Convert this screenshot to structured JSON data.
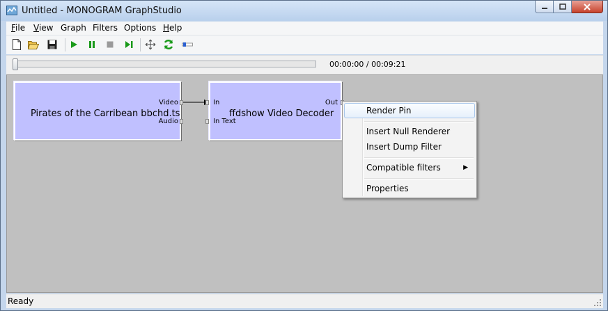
{
  "window": {
    "title": "Untitled - MONOGRAM GraphStudio"
  },
  "menubar": [
    {
      "id": "file",
      "key": "F",
      "rest": "ile"
    },
    {
      "id": "view",
      "key": "V",
      "rest": "iew"
    },
    {
      "id": "graph",
      "key": "",
      "rest": "Graph"
    },
    {
      "id": "filters",
      "key": "",
      "rest": "Filters"
    },
    {
      "id": "options",
      "key": "",
      "rest": "Options"
    },
    {
      "id": "help",
      "key": "H",
      "rest": "elp"
    }
  ],
  "toolbar": {
    "icons": [
      "new-document-icon",
      "open-folder-icon",
      "save-disk-icon",
      "play-icon",
      "pause-icon",
      "stop-icon",
      "step-frame-icon",
      "arrange-icon",
      "refresh-icon",
      "seek-mode-icon"
    ]
  },
  "seekbar": {
    "time": "00:00:00 / 00:09:21",
    "position": 0
  },
  "graph": {
    "filters": [
      {
        "name": "Pirates of the Carribean bbchd.ts",
        "out_pins": [
          "Video",
          "Audio"
        ]
      },
      {
        "name": "ffdshow Video Decoder",
        "in_pins": [
          "In",
          "In Text"
        ],
        "out_pins": [
          "Out"
        ]
      }
    ]
  },
  "context_menu": {
    "items": [
      {
        "label": "Render Pin",
        "highlighted": true
      },
      {
        "label": "Insert Null Renderer"
      },
      {
        "label": "Insert Dump Filter"
      },
      {
        "label": "Compatible filters",
        "submenu": true
      },
      {
        "label": "Properties"
      }
    ]
  },
  "status": {
    "text": "Ready"
  },
  "colors": {
    "filter_fill": "#c0c0ff",
    "canvas": "#c0c0c0",
    "play_green": "#1a9a1a"
  }
}
